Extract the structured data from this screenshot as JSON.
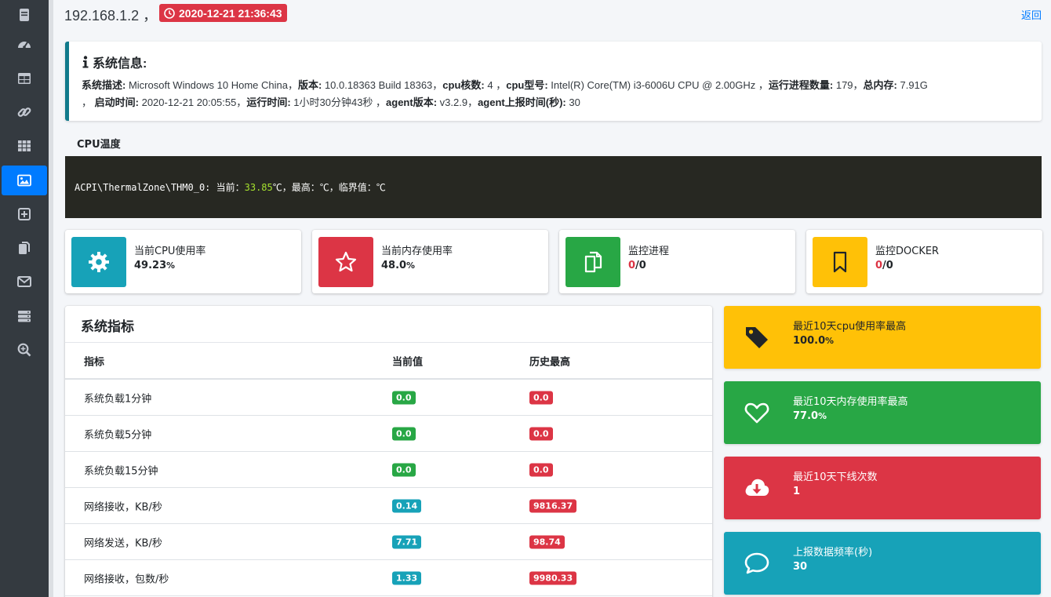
{
  "sidebar": {
    "items": [
      {
        "icon": "book-icon"
      },
      {
        "icon": "tachometer-icon"
      },
      {
        "icon": "table-icon"
      },
      {
        "icon": "link-icon"
      },
      {
        "icon": "grid-icon"
      },
      {
        "icon": "image-icon",
        "active": true
      },
      {
        "icon": "plus-square-icon"
      },
      {
        "icon": "copy-icon"
      },
      {
        "icon": "envelope-icon"
      },
      {
        "icon": "server-icon"
      },
      {
        "icon": "search-plus-icon"
      }
    ]
  },
  "header": {
    "ip": "192.168.1.2 ，",
    "time": "2020-12-21 21:36:43",
    "back": "返回"
  },
  "sysinfo": {
    "title": "系统信息:",
    "desc_label": "系统描述:",
    "desc": " Microsoft Windows 10 Home China，",
    "version_label": "版本:",
    "version": " 10.0.18363 Build 18363，",
    "cores_label": "cpu核数:",
    "cores": " 4 ，",
    "model_label": "cpu型号:",
    "model": " Intel(R) Core(TM) i3-6006U CPU @ 2.00GHz ，",
    "procs_label": "运行进程数量:",
    "procs": " 179，",
    "mem_label": "总内存:",
    "mem": " 7.91G",
    "start_prefix": "，",
    "start_label": "启动时间:",
    "start": " 2020-12-21 20:05:55，",
    "uptime_label": "运行时间:",
    "uptime": " 1小时30分钟43秒 ，",
    "agent_label": "agent版本:",
    "agent": " v3.2.9，",
    "report_label": "agent上报时间(秒):",
    "report": " 30"
  },
  "cpu_temp": {
    "title": "CPU温度",
    "prefix": "ACPI\\ThermalZone\\THM0_0:  当前：",
    "current": "33.85",
    "suffix": "℃，最高：℃，临界值：℃"
  },
  "info_boxes": [
    {
      "label": "当前CPU使用率",
      "value": "49.23",
      "unit": "%",
      "color": "#17a2b8",
      "icon": "gear-icon"
    },
    {
      "label": "当前内存使用率",
      "value": "48.0",
      "unit": "%",
      "color": "#dc3545",
      "icon": "star-icon"
    },
    {
      "label": "监控进程",
      "red": "0",
      "rest": "/0",
      "color": "#28a745",
      "icon": "copy-icon"
    },
    {
      "label": "监控DOCKER",
      "red": "0",
      "rest": "/0",
      "color": "#ffc107",
      "icon": "bookmark-icon"
    }
  ],
  "metrics": {
    "title": "系统指标",
    "headers": [
      "指标",
      "当前值",
      "历史最高"
    ],
    "rows": [
      {
        "name": "系统负载1分钟",
        "current": "0.0",
        "max": "0.0"
      },
      {
        "name": "系统负载5分钟",
        "current": "0.0",
        "max": "0.0"
      },
      {
        "name": "系统负载15分钟",
        "current": "0.0",
        "max": "0.0"
      },
      {
        "name": "网络接收，KB/秒",
        "current": "0.14",
        "max": "9816.37"
      },
      {
        "name": "网络发送，KB/秒",
        "current": "7.71",
        "max": "98.74"
      },
      {
        "name": "网络接收，包数/秒",
        "current": "1.33",
        "max": "9980.33"
      }
    ]
  },
  "stat_boxes": [
    {
      "label": "最近10天cpu使用率最高",
      "value": "100.0",
      "unit": "%",
      "color": "#ffc107",
      "icon": "tag-icon"
    },
    {
      "label": "最近10天内存使用率最高",
      "value": "77.0",
      "unit": "%",
      "color": "#28a745",
      "icon": "heart-icon"
    },
    {
      "label": "最近10天下线次数",
      "value": "1",
      "unit": "",
      "color": "#dc3545",
      "icon": "cloud-download-icon"
    },
    {
      "label": "上报数据频率(秒)",
      "value": "30",
      "unit": "",
      "color": "#17a2b8",
      "icon": "comment-icon"
    }
  ]
}
